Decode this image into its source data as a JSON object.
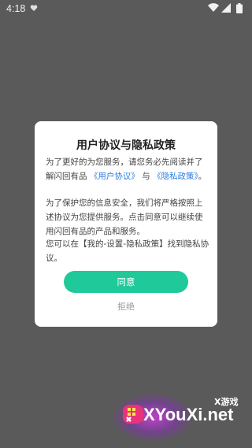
{
  "status_bar": {
    "time": "4:18",
    "icons": [
      "heart-icon",
      "wifi-icon",
      "signal-icon",
      "battery-icon"
    ]
  },
  "dialog": {
    "title": "用户协议与隐私政策",
    "p1_text": "为了更好的为您服务，请您务必先阅读并了解闪回有品",
    "user_agreement_link": "《用户协议》",
    "and_text": "与",
    "privacy_policy_link": "《隐私政策》",
    "p1_end": "。",
    "p2": "为了保护您的信息安全，我们将严格按照上述协议为您提供服务。点击同意可以继续使用闪回有品的产品和服务。",
    "p3": "您可以在【我的-设置-隐私政策】找到隐私协议。",
    "agree_label": "同意",
    "reject_label": "拒绝"
  },
  "watermark": {
    "tag": "X游戏",
    "brand": "XYouXi.net"
  },
  "colors": {
    "overlay": "#5a5a5a",
    "accent": "#1fc99a",
    "link": "#2f7fe0"
  }
}
